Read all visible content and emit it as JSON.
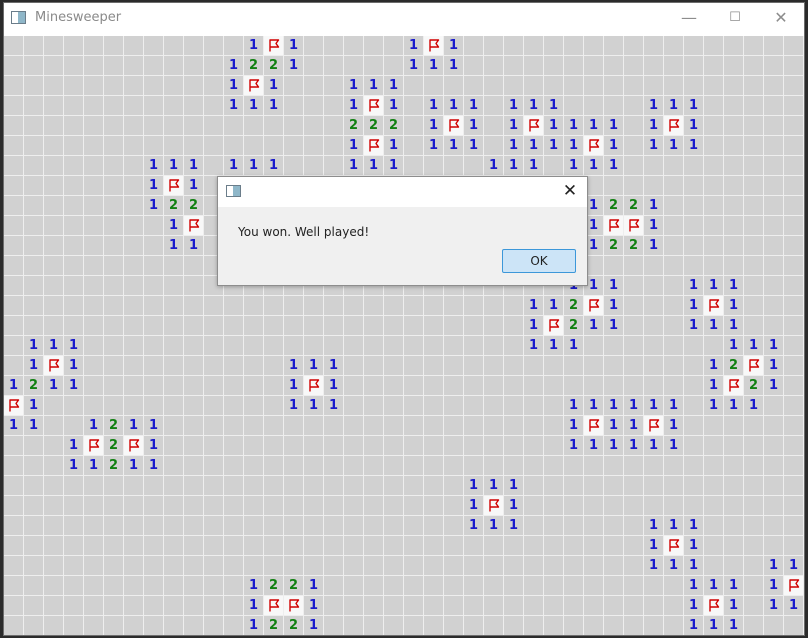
{
  "window": {
    "title": "Minesweeper",
    "minimize_glyph": "—",
    "maximize_glyph": "☐",
    "close_glyph": "✕"
  },
  "board": {
    "rows": 30,
    "cols": 40,
    "flag_color": "#d00000",
    "cells": [
      {
        "r": 0,
        "c": 12,
        "v": "1"
      },
      {
        "r": 0,
        "c": 13,
        "v": "F"
      },
      {
        "r": 0,
        "c": 14,
        "v": "1"
      },
      {
        "r": 0,
        "c": 20,
        "v": "1"
      },
      {
        "r": 0,
        "c": 21,
        "v": "F"
      },
      {
        "r": 0,
        "c": 22,
        "v": "1"
      },
      {
        "r": 1,
        "c": 11,
        "v": "1"
      },
      {
        "r": 1,
        "c": 12,
        "v": "2"
      },
      {
        "r": 1,
        "c": 13,
        "v": "2"
      },
      {
        "r": 1,
        "c": 14,
        "v": "1"
      },
      {
        "r": 1,
        "c": 20,
        "v": "1"
      },
      {
        "r": 1,
        "c": 21,
        "v": "1"
      },
      {
        "r": 1,
        "c": 22,
        "v": "1"
      },
      {
        "r": 2,
        "c": 11,
        "v": "1"
      },
      {
        "r": 2,
        "c": 12,
        "v": "F"
      },
      {
        "r": 2,
        "c": 13,
        "v": "1"
      },
      {
        "r": 2,
        "c": 17,
        "v": "1"
      },
      {
        "r": 2,
        "c": 18,
        "v": "1"
      },
      {
        "r": 2,
        "c": 19,
        "v": "1"
      },
      {
        "r": 3,
        "c": 11,
        "v": "1"
      },
      {
        "r": 3,
        "c": 12,
        "v": "1"
      },
      {
        "r": 3,
        "c": 13,
        "v": "1"
      },
      {
        "r": 3,
        "c": 17,
        "v": "1"
      },
      {
        "r": 3,
        "c": 18,
        "v": "F"
      },
      {
        "r": 3,
        "c": 19,
        "v": "1"
      },
      {
        "r": 3,
        "c": 21,
        "v": "1"
      },
      {
        "r": 3,
        "c": 22,
        "v": "1"
      },
      {
        "r": 3,
        "c": 23,
        "v": "1"
      },
      {
        "r": 3,
        "c": 25,
        "v": "1"
      },
      {
        "r": 3,
        "c": 26,
        "v": "1"
      },
      {
        "r": 3,
        "c": 27,
        "v": "1"
      },
      {
        "r": 3,
        "c": 32,
        "v": "1"
      },
      {
        "r": 3,
        "c": 33,
        "v": "1"
      },
      {
        "r": 3,
        "c": 34,
        "v": "1"
      },
      {
        "r": 4,
        "c": 17,
        "v": "2"
      },
      {
        "r": 4,
        "c": 18,
        "v": "2"
      },
      {
        "r": 4,
        "c": 19,
        "v": "2"
      },
      {
        "r": 4,
        "c": 21,
        "v": "1"
      },
      {
        "r": 4,
        "c": 22,
        "v": "F"
      },
      {
        "r": 4,
        "c": 23,
        "v": "1"
      },
      {
        "r": 4,
        "c": 25,
        "v": "1"
      },
      {
        "r": 4,
        "c": 26,
        "v": "F"
      },
      {
        "r": 4,
        "c": 27,
        "v": "1"
      },
      {
        "r": 4,
        "c": 28,
        "v": "1"
      },
      {
        "r": 4,
        "c": 29,
        "v": "1"
      },
      {
        "r": 4,
        "c": 30,
        "v": "1"
      },
      {
        "r": 4,
        "c": 32,
        "v": "1"
      },
      {
        "r": 4,
        "c": 33,
        "v": "F"
      },
      {
        "r": 4,
        "c": 34,
        "v": "1"
      },
      {
        "r": 5,
        "c": 17,
        "v": "1"
      },
      {
        "r": 5,
        "c": 18,
        "v": "F"
      },
      {
        "r": 5,
        "c": 19,
        "v": "1"
      },
      {
        "r": 5,
        "c": 21,
        "v": "1"
      },
      {
        "r": 5,
        "c": 22,
        "v": "1"
      },
      {
        "r": 5,
        "c": 23,
        "v": "1"
      },
      {
        "r": 5,
        "c": 25,
        "v": "1"
      },
      {
        "r": 5,
        "c": 26,
        "v": "1"
      },
      {
        "r": 5,
        "c": 27,
        "v": "1"
      },
      {
        "r": 5,
        "c": 28,
        "v": "1"
      },
      {
        "r": 5,
        "c": 29,
        "v": "F"
      },
      {
        "r": 5,
        "c": 30,
        "v": "1"
      },
      {
        "r": 5,
        "c": 32,
        "v": "1"
      },
      {
        "r": 5,
        "c": 33,
        "v": "1"
      },
      {
        "r": 5,
        "c": 34,
        "v": "1"
      },
      {
        "r": 6,
        "c": 7,
        "v": "1"
      },
      {
        "r": 6,
        "c": 8,
        "v": "1"
      },
      {
        "r": 6,
        "c": 9,
        "v": "1"
      },
      {
        "r": 6,
        "c": 11,
        "v": "1"
      },
      {
        "r": 6,
        "c": 12,
        "v": "1"
      },
      {
        "r": 6,
        "c": 13,
        "v": "1"
      },
      {
        "r": 6,
        "c": 17,
        "v": "1"
      },
      {
        "r": 6,
        "c": 18,
        "v": "1"
      },
      {
        "r": 6,
        "c": 19,
        "v": "1"
      },
      {
        "r": 6,
        "c": 24,
        "v": "1"
      },
      {
        "r": 6,
        "c": 25,
        "v": "1"
      },
      {
        "r": 6,
        "c": 26,
        "v": "1"
      },
      {
        "r": 6,
        "c": 28,
        "v": "1"
      },
      {
        "r": 6,
        "c": 29,
        "v": "1"
      },
      {
        "r": 6,
        "c": 30,
        "v": "1"
      },
      {
        "r": 7,
        "c": 7,
        "v": "1"
      },
      {
        "r": 7,
        "c": 8,
        "v": "F"
      },
      {
        "r": 7,
        "c": 9,
        "v": "1"
      },
      {
        "r": 8,
        "c": 7,
        "v": "1"
      },
      {
        "r": 8,
        "c": 8,
        "v": "2"
      },
      {
        "r": 8,
        "c": 9,
        "v": "2"
      },
      {
        "r": 8,
        "c": 29,
        "v": "1"
      },
      {
        "r": 8,
        "c": 30,
        "v": "2"
      },
      {
        "r": 8,
        "c": 31,
        "v": "2"
      },
      {
        "r": 8,
        "c": 32,
        "v": "1"
      },
      {
        "r": 9,
        "c": 8,
        "v": "1"
      },
      {
        "r": 9,
        "c": 9,
        "v": "F"
      },
      {
        "r": 9,
        "c": 29,
        "v": "1"
      },
      {
        "r": 9,
        "c": 30,
        "v": "F"
      },
      {
        "r": 9,
        "c": 31,
        "v": "F"
      },
      {
        "r": 9,
        "c": 32,
        "v": "1"
      },
      {
        "r": 10,
        "c": 8,
        "v": "1"
      },
      {
        "r": 10,
        "c": 9,
        "v": "1"
      },
      {
        "r": 10,
        "c": 29,
        "v": "1"
      },
      {
        "r": 10,
        "c": 30,
        "v": "2"
      },
      {
        "r": 10,
        "c": 31,
        "v": "2"
      },
      {
        "r": 10,
        "c": 32,
        "v": "1"
      },
      {
        "r": 12,
        "c": 28,
        "v": "1"
      },
      {
        "r": 12,
        "c": 29,
        "v": "1"
      },
      {
        "r": 12,
        "c": 30,
        "v": "1"
      },
      {
        "r": 12,
        "c": 34,
        "v": "1"
      },
      {
        "r": 12,
        "c": 35,
        "v": "1"
      },
      {
        "r": 12,
        "c": 36,
        "v": "1"
      },
      {
        "r": 13,
        "c": 26,
        "v": "1"
      },
      {
        "r": 13,
        "c": 27,
        "v": "1"
      },
      {
        "r": 13,
        "c": 28,
        "v": "2"
      },
      {
        "r": 13,
        "c": 29,
        "v": "F"
      },
      {
        "r": 13,
        "c": 30,
        "v": "1"
      },
      {
        "r": 13,
        "c": 34,
        "v": "1"
      },
      {
        "r": 13,
        "c": 35,
        "v": "F"
      },
      {
        "r": 13,
        "c": 36,
        "v": "1"
      },
      {
        "r": 14,
        "c": 26,
        "v": "1"
      },
      {
        "r": 14,
        "c": 27,
        "v": "F"
      },
      {
        "r": 14,
        "c": 28,
        "v": "2"
      },
      {
        "r": 14,
        "c": 29,
        "v": "1"
      },
      {
        "r": 14,
        "c": 30,
        "v": "1"
      },
      {
        "r": 14,
        "c": 34,
        "v": "1"
      },
      {
        "r": 14,
        "c": 35,
        "v": "1"
      },
      {
        "r": 14,
        "c": 36,
        "v": "1"
      },
      {
        "r": 15,
        "c": 1,
        "v": "1"
      },
      {
        "r": 15,
        "c": 2,
        "v": "1"
      },
      {
        "r": 15,
        "c": 3,
        "v": "1"
      },
      {
        "r": 15,
        "c": 26,
        "v": "1"
      },
      {
        "r": 15,
        "c": 27,
        "v": "1"
      },
      {
        "r": 15,
        "c": 28,
        "v": "1"
      },
      {
        "r": 15,
        "c": 36,
        "v": "1"
      },
      {
        "r": 15,
        "c": 37,
        "v": "1"
      },
      {
        "r": 15,
        "c": 38,
        "v": "1"
      },
      {
        "r": 16,
        "c": 1,
        "v": "1"
      },
      {
        "r": 16,
        "c": 2,
        "v": "F"
      },
      {
        "r": 16,
        "c": 3,
        "v": "1"
      },
      {
        "r": 16,
        "c": 14,
        "v": "1"
      },
      {
        "r": 16,
        "c": 15,
        "v": "1"
      },
      {
        "r": 16,
        "c": 16,
        "v": "1"
      },
      {
        "r": 16,
        "c": 35,
        "v": "1"
      },
      {
        "r": 16,
        "c": 36,
        "v": "2"
      },
      {
        "r": 16,
        "c": 37,
        "v": "F"
      },
      {
        "r": 16,
        "c": 38,
        "v": "1"
      },
      {
        "r": 17,
        "c": 0,
        "v": "1"
      },
      {
        "r": 17,
        "c": 1,
        "v": "2"
      },
      {
        "r": 17,
        "c": 2,
        "v": "1"
      },
      {
        "r": 17,
        "c": 3,
        "v": "1"
      },
      {
        "r": 17,
        "c": 14,
        "v": "1"
      },
      {
        "r": 17,
        "c": 15,
        "v": "F"
      },
      {
        "r": 17,
        "c": 16,
        "v": "1"
      },
      {
        "r": 17,
        "c": 35,
        "v": "1"
      },
      {
        "r": 17,
        "c": 36,
        "v": "F"
      },
      {
        "r": 17,
        "c": 37,
        "v": "2"
      },
      {
        "r": 17,
        "c": 38,
        "v": "1"
      },
      {
        "r": 18,
        "c": 0,
        "v": "F"
      },
      {
        "r": 18,
        "c": 1,
        "v": "1"
      },
      {
        "r": 18,
        "c": 14,
        "v": "1"
      },
      {
        "r": 18,
        "c": 15,
        "v": "1"
      },
      {
        "r": 18,
        "c": 16,
        "v": "1"
      },
      {
        "r": 18,
        "c": 28,
        "v": "1"
      },
      {
        "r": 18,
        "c": 29,
        "v": "1"
      },
      {
        "r": 18,
        "c": 30,
        "v": "1"
      },
      {
        "r": 18,
        "c": 31,
        "v": "1"
      },
      {
        "r": 18,
        "c": 32,
        "v": "1"
      },
      {
        "r": 18,
        "c": 33,
        "v": "1"
      },
      {
        "r": 18,
        "c": 35,
        "v": "1"
      },
      {
        "r": 18,
        "c": 36,
        "v": "1"
      },
      {
        "r": 18,
        "c": 37,
        "v": "1"
      },
      {
        "r": 19,
        "c": 0,
        "v": "1"
      },
      {
        "r": 19,
        "c": 1,
        "v": "1"
      },
      {
        "r": 19,
        "c": 4,
        "v": "1"
      },
      {
        "r": 19,
        "c": 5,
        "v": "2"
      },
      {
        "r": 19,
        "c": 6,
        "v": "1"
      },
      {
        "r": 19,
        "c": 7,
        "v": "1"
      },
      {
        "r": 19,
        "c": 28,
        "v": "1"
      },
      {
        "r": 19,
        "c": 29,
        "v": "F"
      },
      {
        "r": 19,
        "c": 30,
        "v": "1"
      },
      {
        "r": 19,
        "c": 31,
        "v": "1"
      },
      {
        "r": 19,
        "c": 32,
        "v": "F"
      },
      {
        "r": 19,
        "c": 33,
        "v": "1"
      },
      {
        "r": 20,
        "c": 3,
        "v": "1"
      },
      {
        "r": 20,
        "c": 4,
        "v": "F"
      },
      {
        "r": 20,
        "c": 5,
        "v": "2"
      },
      {
        "r": 20,
        "c": 6,
        "v": "F"
      },
      {
        "r": 20,
        "c": 7,
        "v": "1"
      },
      {
        "r": 20,
        "c": 28,
        "v": "1"
      },
      {
        "r": 20,
        "c": 29,
        "v": "1"
      },
      {
        "r": 20,
        "c": 30,
        "v": "1"
      },
      {
        "r": 20,
        "c": 31,
        "v": "1"
      },
      {
        "r": 20,
        "c": 32,
        "v": "1"
      },
      {
        "r": 20,
        "c": 33,
        "v": "1"
      },
      {
        "r": 21,
        "c": 3,
        "v": "1"
      },
      {
        "r": 21,
        "c": 4,
        "v": "1"
      },
      {
        "r": 21,
        "c": 5,
        "v": "2"
      },
      {
        "r": 21,
        "c": 6,
        "v": "1"
      },
      {
        "r": 21,
        "c": 7,
        "v": "1"
      },
      {
        "r": 22,
        "c": 23,
        "v": "1"
      },
      {
        "r": 22,
        "c": 24,
        "v": "1"
      },
      {
        "r": 22,
        "c": 25,
        "v": "1"
      },
      {
        "r": 23,
        "c": 23,
        "v": "1"
      },
      {
        "r": 23,
        "c": 24,
        "v": "F"
      },
      {
        "r": 23,
        "c": 25,
        "v": "1"
      },
      {
        "r": 24,
        "c": 23,
        "v": "1"
      },
      {
        "r": 24,
        "c": 24,
        "v": "1"
      },
      {
        "r": 24,
        "c": 25,
        "v": "1"
      },
      {
        "r": 24,
        "c": 32,
        "v": "1"
      },
      {
        "r": 24,
        "c": 33,
        "v": "1"
      },
      {
        "r": 24,
        "c": 34,
        "v": "1"
      },
      {
        "r": 25,
        "c": 32,
        "v": "1"
      },
      {
        "r": 25,
        "c": 33,
        "v": "F"
      },
      {
        "r": 25,
        "c": 34,
        "v": "1"
      },
      {
        "r": 26,
        "c": 32,
        "v": "1"
      },
      {
        "r": 26,
        "c": 33,
        "v": "1"
      },
      {
        "r": 26,
        "c": 34,
        "v": "1"
      },
      {
        "r": 26,
        "c": 38,
        "v": "1"
      },
      {
        "r": 26,
        "c": 39,
        "v": "1"
      },
      {
        "r": 27,
        "c": 12,
        "v": "1"
      },
      {
        "r": 27,
        "c": 13,
        "v": "2"
      },
      {
        "r": 27,
        "c": 14,
        "v": "2"
      },
      {
        "r": 27,
        "c": 15,
        "v": "1"
      },
      {
        "r": 27,
        "c": 34,
        "v": "1"
      },
      {
        "r": 27,
        "c": 35,
        "v": "1"
      },
      {
        "r": 27,
        "c": 36,
        "v": "1"
      },
      {
        "r": 27,
        "c": 38,
        "v": "1"
      },
      {
        "r": 27,
        "c": 39,
        "v": "F"
      },
      {
        "r": 28,
        "c": 12,
        "v": "1"
      },
      {
        "r": 28,
        "c": 13,
        "v": "F"
      },
      {
        "r": 28,
        "c": 14,
        "v": "F"
      },
      {
        "r": 28,
        "c": 15,
        "v": "1"
      },
      {
        "r": 28,
        "c": 34,
        "v": "1"
      },
      {
        "r": 28,
        "c": 35,
        "v": "F"
      },
      {
        "r": 28,
        "c": 36,
        "v": "1"
      },
      {
        "r": 28,
        "c": 38,
        "v": "1"
      },
      {
        "r": 28,
        "c": 39,
        "v": "1"
      },
      {
        "r": 29,
        "c": 12,
        "v": "1"
      },
      {
        "r": 29,
        "c": 13,
        "v": "2"
      },
      {
        "r": 29,
        "c": 14,
        "v": "2"
      },
      {
        "r": 29,
        "c": 15,
        "v": "1"
      },
      {
        "r": 29,
        "c": 34,
        "v": "1"
      },
      {
        "r": 29,
        "c": 35,
        "v": "1"
      },
      {
        "r": 29,
        "c": 36,
        "v": "1"
      }
    ]
  },
  "dialog": {
    "message": "You won. Well played!",
    "ok_label": "OK",
    "close_glyph": "✕"
  }
}
